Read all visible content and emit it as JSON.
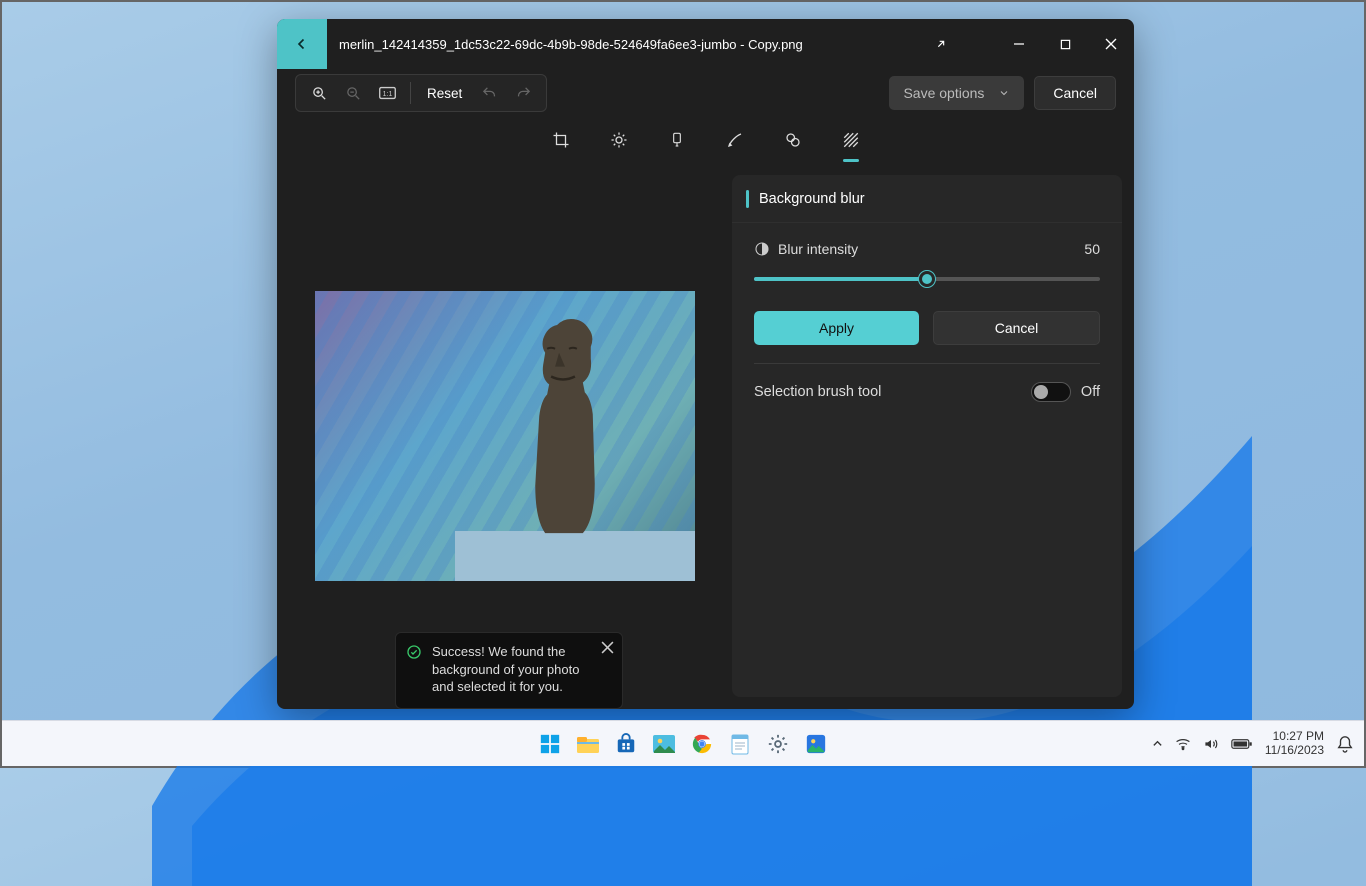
{
  "window": {
    "title": "merlin_142414359_1dc53c22-69dc-4b9b-98de-524649fa6ee3-jumbo - Copy.png",
    "reset_label": "Reset",
    "save_label": "Save options",
    "cancel_label": "Cancel"
  },
  "panel": {
    "title": "Background blur",
    "blur_label": "Blur intensity",
    "blur_value": "50",
    "slider_percent": 50,
    "apply_label": "Apply",
    "cancel_label": "Cancel",
    "toggle_label": "Selection brush tool",
    "toggle_state": "Off"
  },
  "toast": {
    "text": "Success! We found the background of your photo and selected it for you."
  },
  "taskbar": {
    "time": "10:27 PM",
    "date": "11/16/2023"
  },
  "colors": {
    "accent": "#4ec3c7",
    "primary": "#55cfd3"
  }
}
